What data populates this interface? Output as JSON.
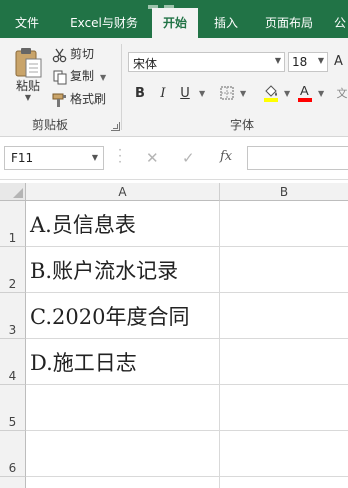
{
  "ribbon": {
    "tabs": [
      {
        "label": "文件"
      },
      {
        "label": "Excel与财务"
      },
      {
        "label": "开始"
      },
      {
        "label": "插入"
      },
      {
        "label": "页面布局"
      },
      {
        "label": "公"
      }
    ],
    "clipboard": {
      "paste_label": "粘贴",
      "cut_label": "剪切",
      "copy_label": "复制",
      "format_painter_label": "格式刷",
      "group_label": "剪贴板"
    },
    "font": {
      "font_name": "宋体",
      "font_size": "18",
      "group_label": "字体",
      "bold": "B",
      "italic": "I",
      "underline": "U"
    },
    "colors": {
      "accent": "#217346",
      "highlight": "#ffff00",
      "font_color": "#ff0000"
    }
  },
  "formula_bar": {
    "name_box": "F11",
    "fx_label": "fx",
    "formula": ""
  },
  "sheet": {
    "columns": [
      "A",
      "B"
    ],
    "rows": [
      {
        "num": "1",
        "a": "A.员信息表",
        "b": ""
      },
      {
        "num": "2",
        "a": "B.账户流水记录",
        "b": ""
      },
      {
        "num": "3",
        "a": "C.2020年度合同",
        "b": ""
      },
      {
        "num": "4",
        "a": "D.施工日志",
        "b": ""
      },
      {
        "num": "5",
        "a": "",
        "b": ""
      },
      {
        "num": "6",
        "a": "",
        "b": ""
      }
    ]
  }
}
